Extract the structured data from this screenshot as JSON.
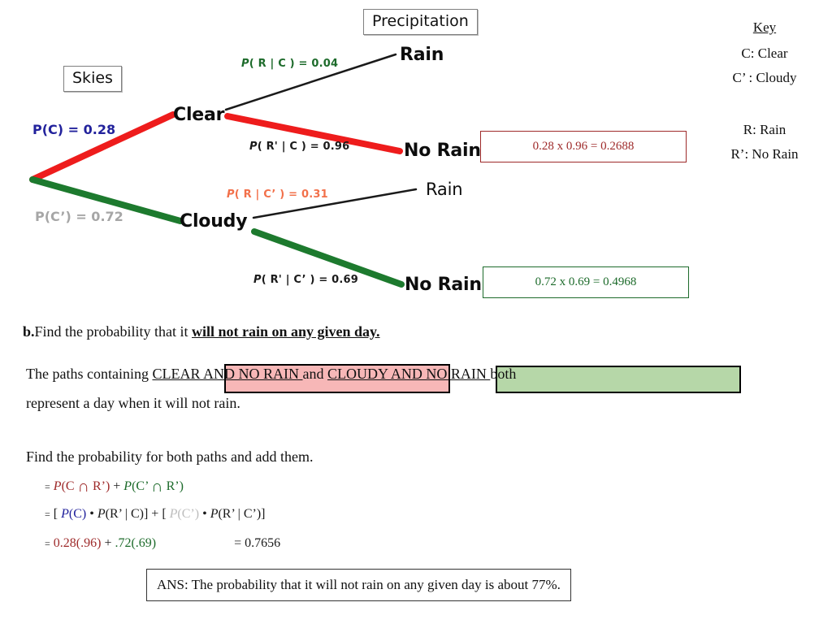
{
  "headers": {
    "skies": "Skies",
    "precipitation": "Precipitation"
  },
  "tree": {
    "root_branches": [
      {
        "label": "P(C) = 0.28",
        "node": "Clear",
        "color": "#ee1c1c"
      },
      {
        "label": "P(C’) = 0.72",
        "node": "Cloudy",
        "color": "#1d7a2e"
      }
    ],
    "clear_branches": [
      {
        "label_p": "P",
        "label_rest": "( R | C ) = 0.04",
        "outcome": "Rain",
        "color": "#1a1a1a"
      },
      {
        "label_p": "P",
        "label_rest": "( R' | C ) = 0.96",
        "outcome": "No Rain",
        "color": "#ee1c1c"
      }
    ],
    "cloudy_branches": [
      {
        "label_p": "P",
        "label_rest": "( R | C’ ) = 0.31",
        "outcome": "Rain",
        "color": "#1a1a1a"
      },
      {
        "label_p": "P",
        "label_rest": "( R' | C’ ) = 0.69",
        "outcome": "No Rain",
        "color": "#1d7a2e"
      }
    ],
    "results": [
      {
        "text": "0.28 x 0.96 = 0.2688",
        "color": "#9e2a2a"
      },
      {
        "text": "0.72 x 0.69 = 0.4968",
        "color": "#1d6b2b"
      }
    ]
  },
  "key": {
    "title": "Key",
    "lines": [
      "C: Clear",
      "C’ : Cloudy",
      "R: Rain",
      "R’: No Rain"
    ]
  },
  "question": {
    "marker": "b.",
    "lead": "Find the probability that it ",
    "emphasis": "will not rain on any given day."
  },
  "explanation": {
    "line1_a": "The paths containing ",
    "line1_b": "CLEAR AND NO RAIN ",
    "line1_c": "and ",
    "line1_d": "CLOUDY AND NO RAIN ",
    "line1_e": "both",
    "line2": "represent a day when it will not rain."
  },
  "instruction": "Find the probability for both paths and add them.",
  "equations": {
    "line1": {
      "eq": "=",
      "p1": "P",
      "t1": "(C ",
      "cap1": "∩",
      "t2": " R’)",
      "plus": "+",
      "p2": "P",
      "t3": "(C’ ",
      "cap2": "∩",
      "t4": " R’)"
    },
    "line2": {
      "eq": "=",
      "open1": "[ ",
      "p1": "P",
      "t1": "(C)",
      "dot1": " • ",
      "p2": "P",
      "t2": "(R’ | C)]",
      "plus": " + ",
      "open2": "[ ",
      "p3": "P",
      "t3": "(C’)",
      "dot2": " • ",
      "p4": "P",
      "t4": "(R’ | C’)]"
    },
    "line3": {
      "eq": "=",
      "red": "0.28(.96)",
      "plus": "+",
      "green": ".72(.69)",
      "result": "= 0.7656"
    }
  },
  "answer": "ANS: The probability that it will not rain on any given day is about 77%."
}
